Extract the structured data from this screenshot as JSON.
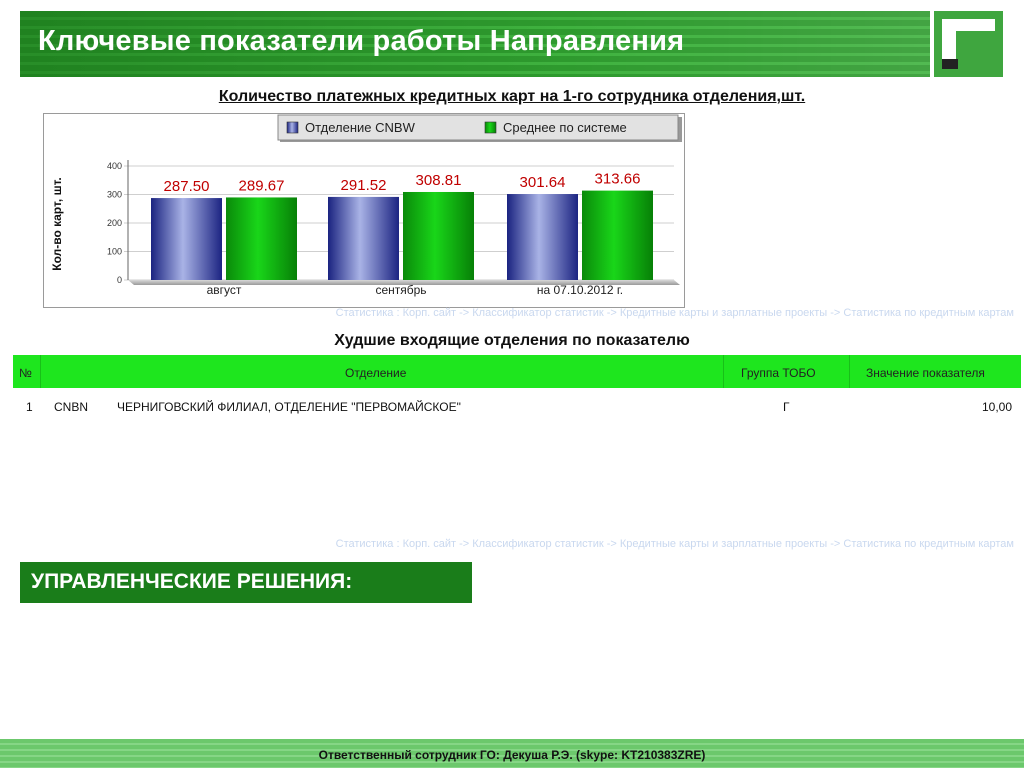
{
  "header": {
    "title": "Ключевые показатели работы Направления",
    "logo_icon": "bank-logo-icon"
  },
  "chart_title": "Количество платежных кредитных карт на 1-го сотрудника отделения,шт.",
  "chart_data": {
    "type": "bar",
    "categories": [
      "август",
      "сентябрь",
      "на 07.10.2012 г."
    ],
    "series": [
      {
        "name": "Отделение CNBW",
        "values": [
          287.5,
          291.52,
          301.64
        ],
        "labels": [
          "287.50",
          "291.52",
          "301.64"
        ],
        "color": "#2a3190"
      },
      {
        "name": "Среднее по системе",
        "values": [
          289.67,
          308.81,
          313.66
        ],
        "labels": [
          "289.67",
          "308.81",
          "313.66"
        ],
        "color": "#0b9a0b"
      }
    ],
    "ylabel": "Кол-во карт, шт.",
    "ylim": [
      0,
      400
    ],
    "yticks": [
      0,
      100,
      200,
      300,
      400
    ],
    "legend_position": "top",
    "data_label_color": "#c00000"
  },
  "links": {
    "stats_path_1": "Статистика : Корп. сайт -> Классификатор статистик -> Кредитные карты и зарплатные проекты -> Статистика по кредитным картам",
    "stats_path_2": "Статистика : Корп. сайт -> Классификатор статистик -> Кредитные карты и зарплатные проекты -> Статистика по кредитным картам"
  },
  "worst": {
    "title": "Худшие входящие отделения по показателю",
    "headers": {
      "num": "№",
      "branch": "Отделение",
      "group": "Группа ТОБО",
      "value": "Значение показателя"
    },
    "rows": [
      {
        "num": "1",
        "code": "CNBN",
        "name": "ЧЕРНИГОВСКИЙ ФИЛИАЛ, ОТДЕЛЕНИЕ \"ПЕРВОМАЙСКОЕ\"",
        "group": "Г",
        "value": "10,00"
      }
    ]
  },
  "decisions": {
    "label": "УПРАВЛЕНЧЕСКИЕ РЕШЕНИЯ:"
  },
  "footer": {
    "text": "Ответственный сотрудник ГО: Декуша Р.Э. (skype: KT210383ZRE)"
  }
}
